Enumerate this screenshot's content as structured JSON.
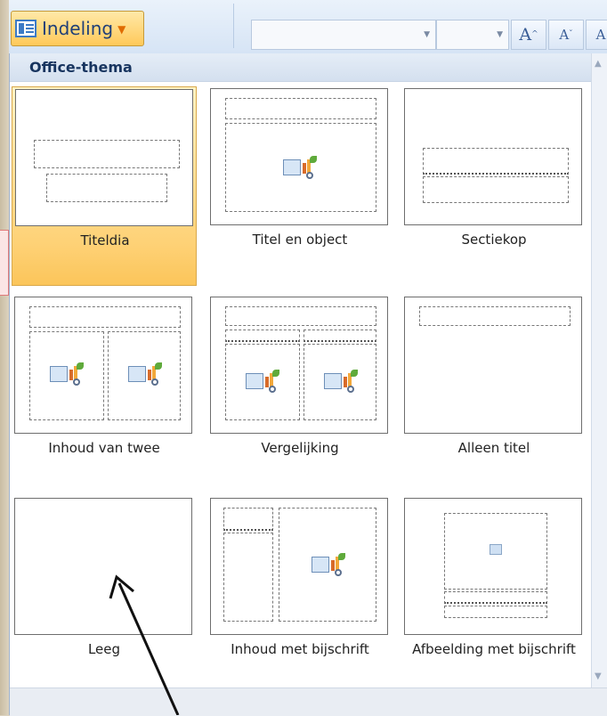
{
  "ribbon": {
    "layout_button": "Indeling",
    "grow_font": "A",
    "shrink_font": "A",
    "clear_format": "A"
  },
  "gallery": {
    "header": "Office-thema",
    "layouts": [
      {
        "label": "Titeldia",
        "selected": true
      },
      {
        "label": "Titel en object",
        "selected": false
      },
      {
        "label": "Sectiekop",
        "selected": false
      },
      {
        "label": "Inhoud van twee",
        "selected": false
      },
      {
        "label": "Vergelijking",
        "selected": false
      },
      {
        "label": "Alleen titel",
        "selected": false
      },
      {
        "label": "Leeg",
        "selected": false
      },
      {
        "label": "Inhoud met bijschrift",
        "selected": false
      },
      {
        "label": "Afbeelding met bijschrift",
        "selected": false
      }
    ]
  },
  "colors": {
    "selected_fill": "#fed175",
    "selected_border": "#d9a84a",
    "header_text": "#17345f"
  },
  "icons": [
    "layout-icon",
    "chevron-down-icon",
    "object-placeholder-icon",
    "picture-icon",
    "annotation-arrow"
  ]
}
